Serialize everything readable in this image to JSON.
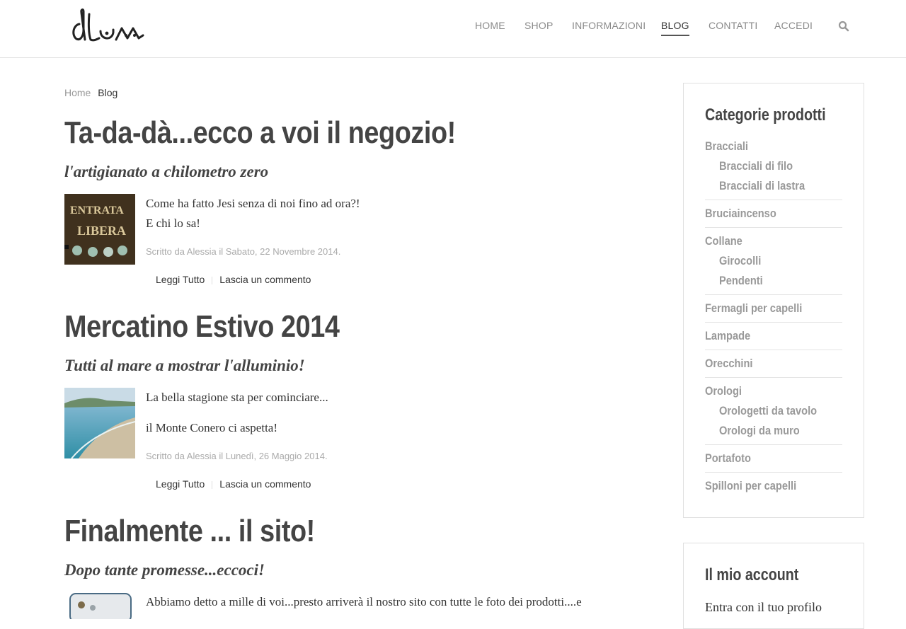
{
  "header": {
    "logo_text": "dLum",
    "nav": [
      {
        "label": "HOME",
        "active": false
      },
      {
        "label": "SHOP",
        "active": false
      },
      {
        "label": "INFORMAZIONI",
        "active": false
      },
      {
        "label": "BLOG",
        "active": true
      },
      {
        "label": "CONTATTI",
        "active": false
      },
      {
        "label": "ACCEDI",
        "active": false
      }
    ],
    "search_icon": "search-icon"
  },
  "breadcrumb": {
    "home": "Home",
    "current": "Blog"
  },
  "posts": [
    {
      "title": "Ta-da-dà...ecco a voi il negozio!",
      "subtitle": "l'artigianato a chilometro zero",
      "excerpt": [
        "Come ha fatto Jesi senza di noi fino ad ora?!",
        "E chi lo sa!"
      ],
      "meta": "Scritto da Alessia il Sabato, 22 Novembre 2014.",
      "read_more": "Leggi Tutto",
      "comment": "Lascia un commento"
    },
    {
      "title": "Mercatino Estivo 2014",
      "subtitle": "Tutti al mare a mostrar l'alluminio!",
      "excerpt": [
        "La bella stagione sta per cominciare...",
        "il Monte Conero ci aspetta!"
      ],
      "meta": "Scritto da Alessia il Lunedì, 26 Maggio 2014.",
      "read_more": "Leggi Tutto",
      "comment": "Lascia un commento"
    },
    {
      "title": "Finalmente ... il sito!",
      "subtitle": "Dopo tante promesse...eccoci!",
      "excerpt": [
        "Abbiamo detto a mille di voi...presto arriverà il nostro sito con tutte le foto dei prodotti....e"
      ]
    }
  ],
  "sidebar": {
    "categories_title": "Categorie prodotti",
    "categories": [
      {
        "label": "Bracciali",
        "children": [
          "Bracciali di filo",
          "Bracciali di lastra"
        ]
      },
      {
        "label": "Bruciaincenso",
        "children": []
      },
      {
        "label": "Collane",
        "children": [
          "Girocolli",
          "Pendenti"
        ]
      },
      {
        "label": "Fermagli per capelli",
        "children": []
      },
      {
        "label": "Lampade",
        "children": []
      },
      {
        "label": "Orecchini",
        "children": []
      },
      {
        "label": "Orologi",
        "children": [
          "Orologetti da tavolo",
          "Orologi da muro"
        ]
      },
      {
        "label": "Portafoto",
        "children": []
      },
      {
        "label": "Spilloni per capelli",
        "children": []
      }
    ],
    "account_title": "Il mio account",
    "account_text": "Entra con il tuo profilo"
  },
  "colors": {
    "text": "#444444",
    "muted": "#999999",
    "border": "#e0e0e0"
  }
}
